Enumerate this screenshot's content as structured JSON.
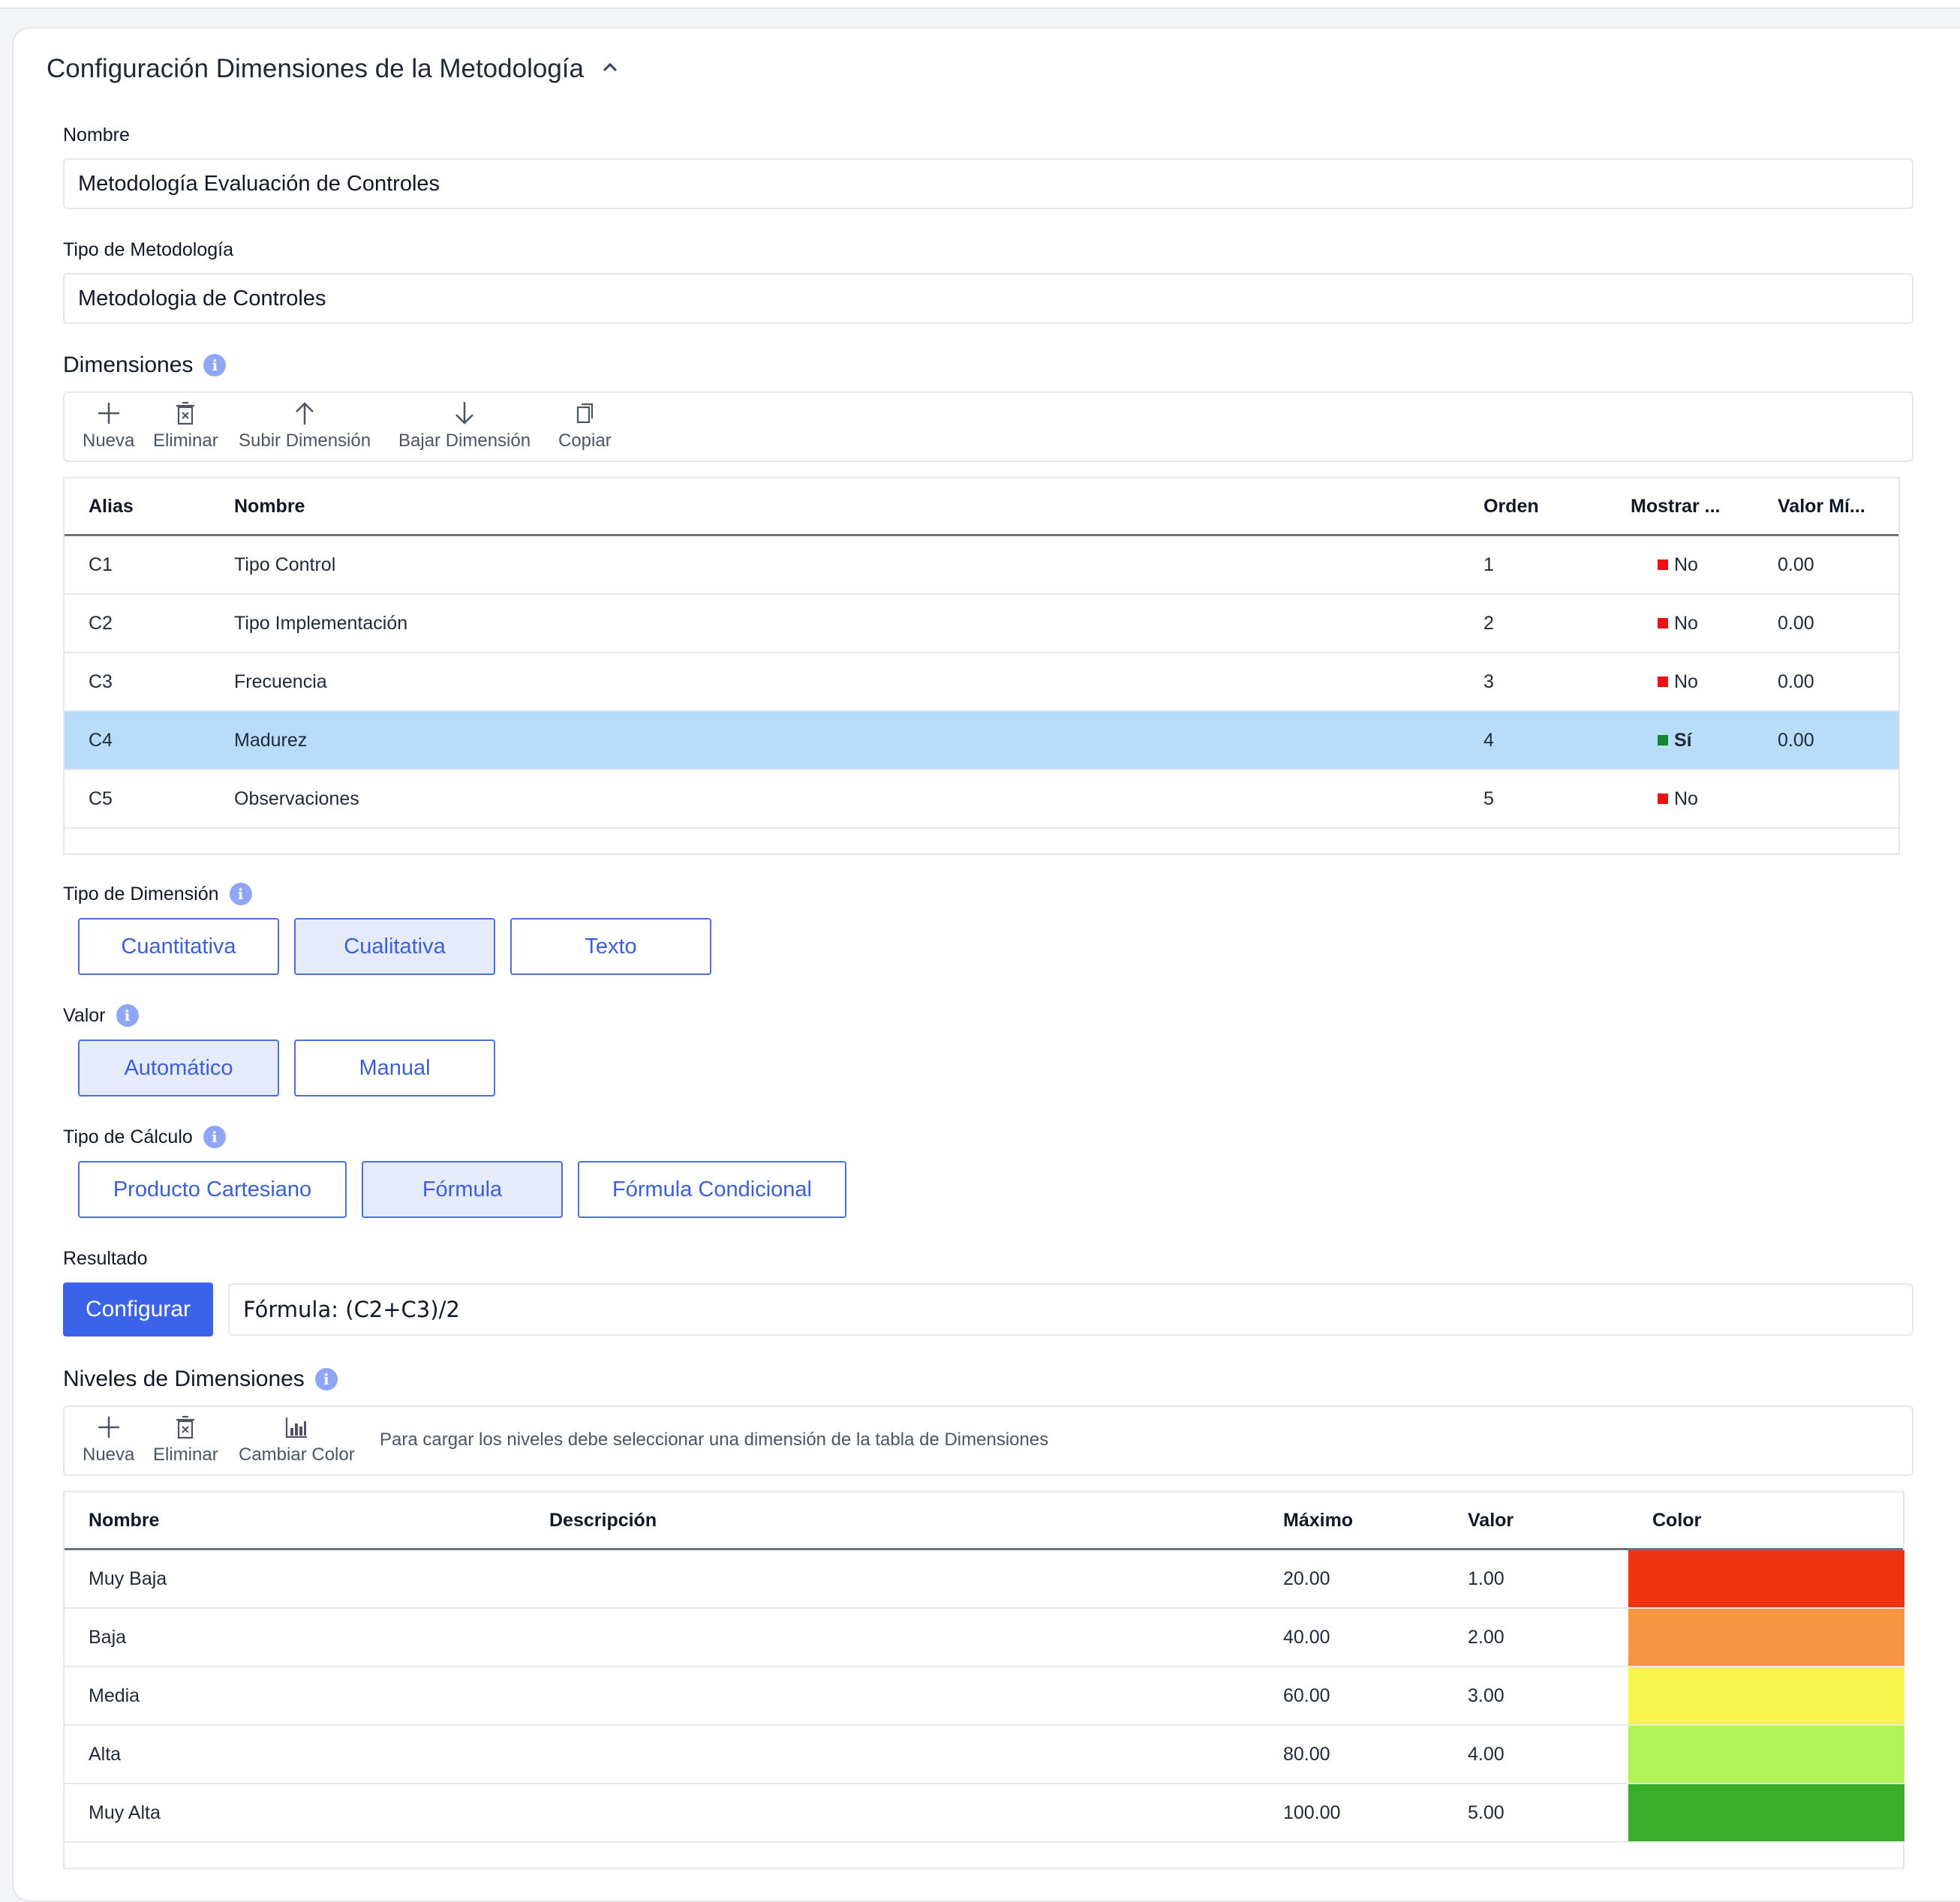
{
  "header": {
    "title": "Configuración Dimensiones de la Metodología"
  },
  "fields": {
    "nombre_label": "Nombre",
    "nombre_value": "Metodología Evaluación de Controles",
    "tipo_label": "Tipo de Metodología",
    "tipo_value": "Metodologia de Controles"
  },
  "dimensiones": {
    "title": "Dimensiones",
    "toolbar": {
      "nueva": "Nueva",
      "eliminar": "Eliminar",
      "subir": "Subir Dimensión",
      "bajar": "Bajar Dimensión",
      "copiar": "Copiar"
    },
    "columns": [
      "Alias",
      "Nombre",
      "Orden",
      "Mostrar ...",
      "Valor Mí..."
    ],
    "rows": [
      {
        "alias": "C1",
        "nombre": "Tipo Control",
        "orden": "1",
        "mostrar": "No",
        "mostrar_color": "#ee1111",
        "valor": "0.00",
        "selected": false
      },
      {
        "alias": "C2",
        "nombre": "Tipo Implementación",
        "orden": "2",
        "mostrar": "No",
        "mostrar_color": "#ee1111",
        "valor": "0.00",
        "selected": false
      },
      {
        "alias": "C3",
        "nombre": "Frecuencia",
        "orden": "3",
        "mostrar": "No",
        "mostrar_color": "#ee1111",
        "valor": "0.00",
        "selected": false
      },
      {
        "alias": "C4",
        "nombre": "Madurez",
        "orden": "4",
        "mostrar": "Sí",
        "mostrar_color": "#118833",
        "valor": "0.00",
        "selected": true
      },
      {
        "alias": "C5",
        "nombre": "Observaciones",
        "orden": "5",
        "mostrar": "No",
        "mostrar_color": "#ee1111",
        "valor": "",
        "selected": false
      }
    ]
  },
  "tipo_dimension": {
    "label": "Tipo de Dimensión",
    "options": [
      "Cuantitativa",
      "Cualitativa",
      "Texto"
    ],
    "selected": "Cualitativa"
  },
  "valor": {
    "label": "Valor",
    "options": [
      "Automático",
      "Manual"
    ],
    "selected": "Automático"
  },
  "tipo_calculo": {
    "label": "Tipo de Cálculo",
    "options": [
      "Producto Cartesiano",
      "Fórmula",
      "Fórmula Condicional"
    ],
    "selected": "Fórmula"
  },
  "resultado": {
    "label": "Resultado",
    "button": "Configurar",
    "formula": "Fórmula: (C2+C3)/2"
  },
  "niveles": {
    "title": "Niveles de Dimensiones",
    "toolbar": {
      "nueva": "Nueva",
      "eliminar": "Eliminar",
      "cambiar_color": "Cambiar Color"
    },
    "hint": "Para cargar los niveles debe seleccionar una dimensión de la tabla de Dimensiones",
    "columns": [
      "Nombre",
      "Descripción",
      "Máximo",
      "Valor",
      "Color"
    ],
    "rows": [
      {
        "nombre": "Muy Baja",
        "descripcion": "",
        "maximo": "20.00",
        "valor": "1.00",
        "color": "#ee3311"
      },
      {
        "nombre": "Baja",
        "descripcion": "",
        "maximo": "40.00",
        "valor": "2.00",
        "color": "#f59542"
      },
      {
        "nombre": "Media",
        "descripcion": "",
        "maximo": "60.00",
        "valor": "3.00",
        "color": "#f7f44c"
      },
      {
        "nombre": "Alta",
        "descripcion": "",
        "maximo": "80.00",
        "valor": "4.00",
        "color": "#b2f455"
      },
      {
        "nombre": "Muy Alta",
        "descripcion": "",
        "maximo": "100.00",
        "valor": "5.00",
        "color": "#3aae2a"
      }
    ]
  }
}
